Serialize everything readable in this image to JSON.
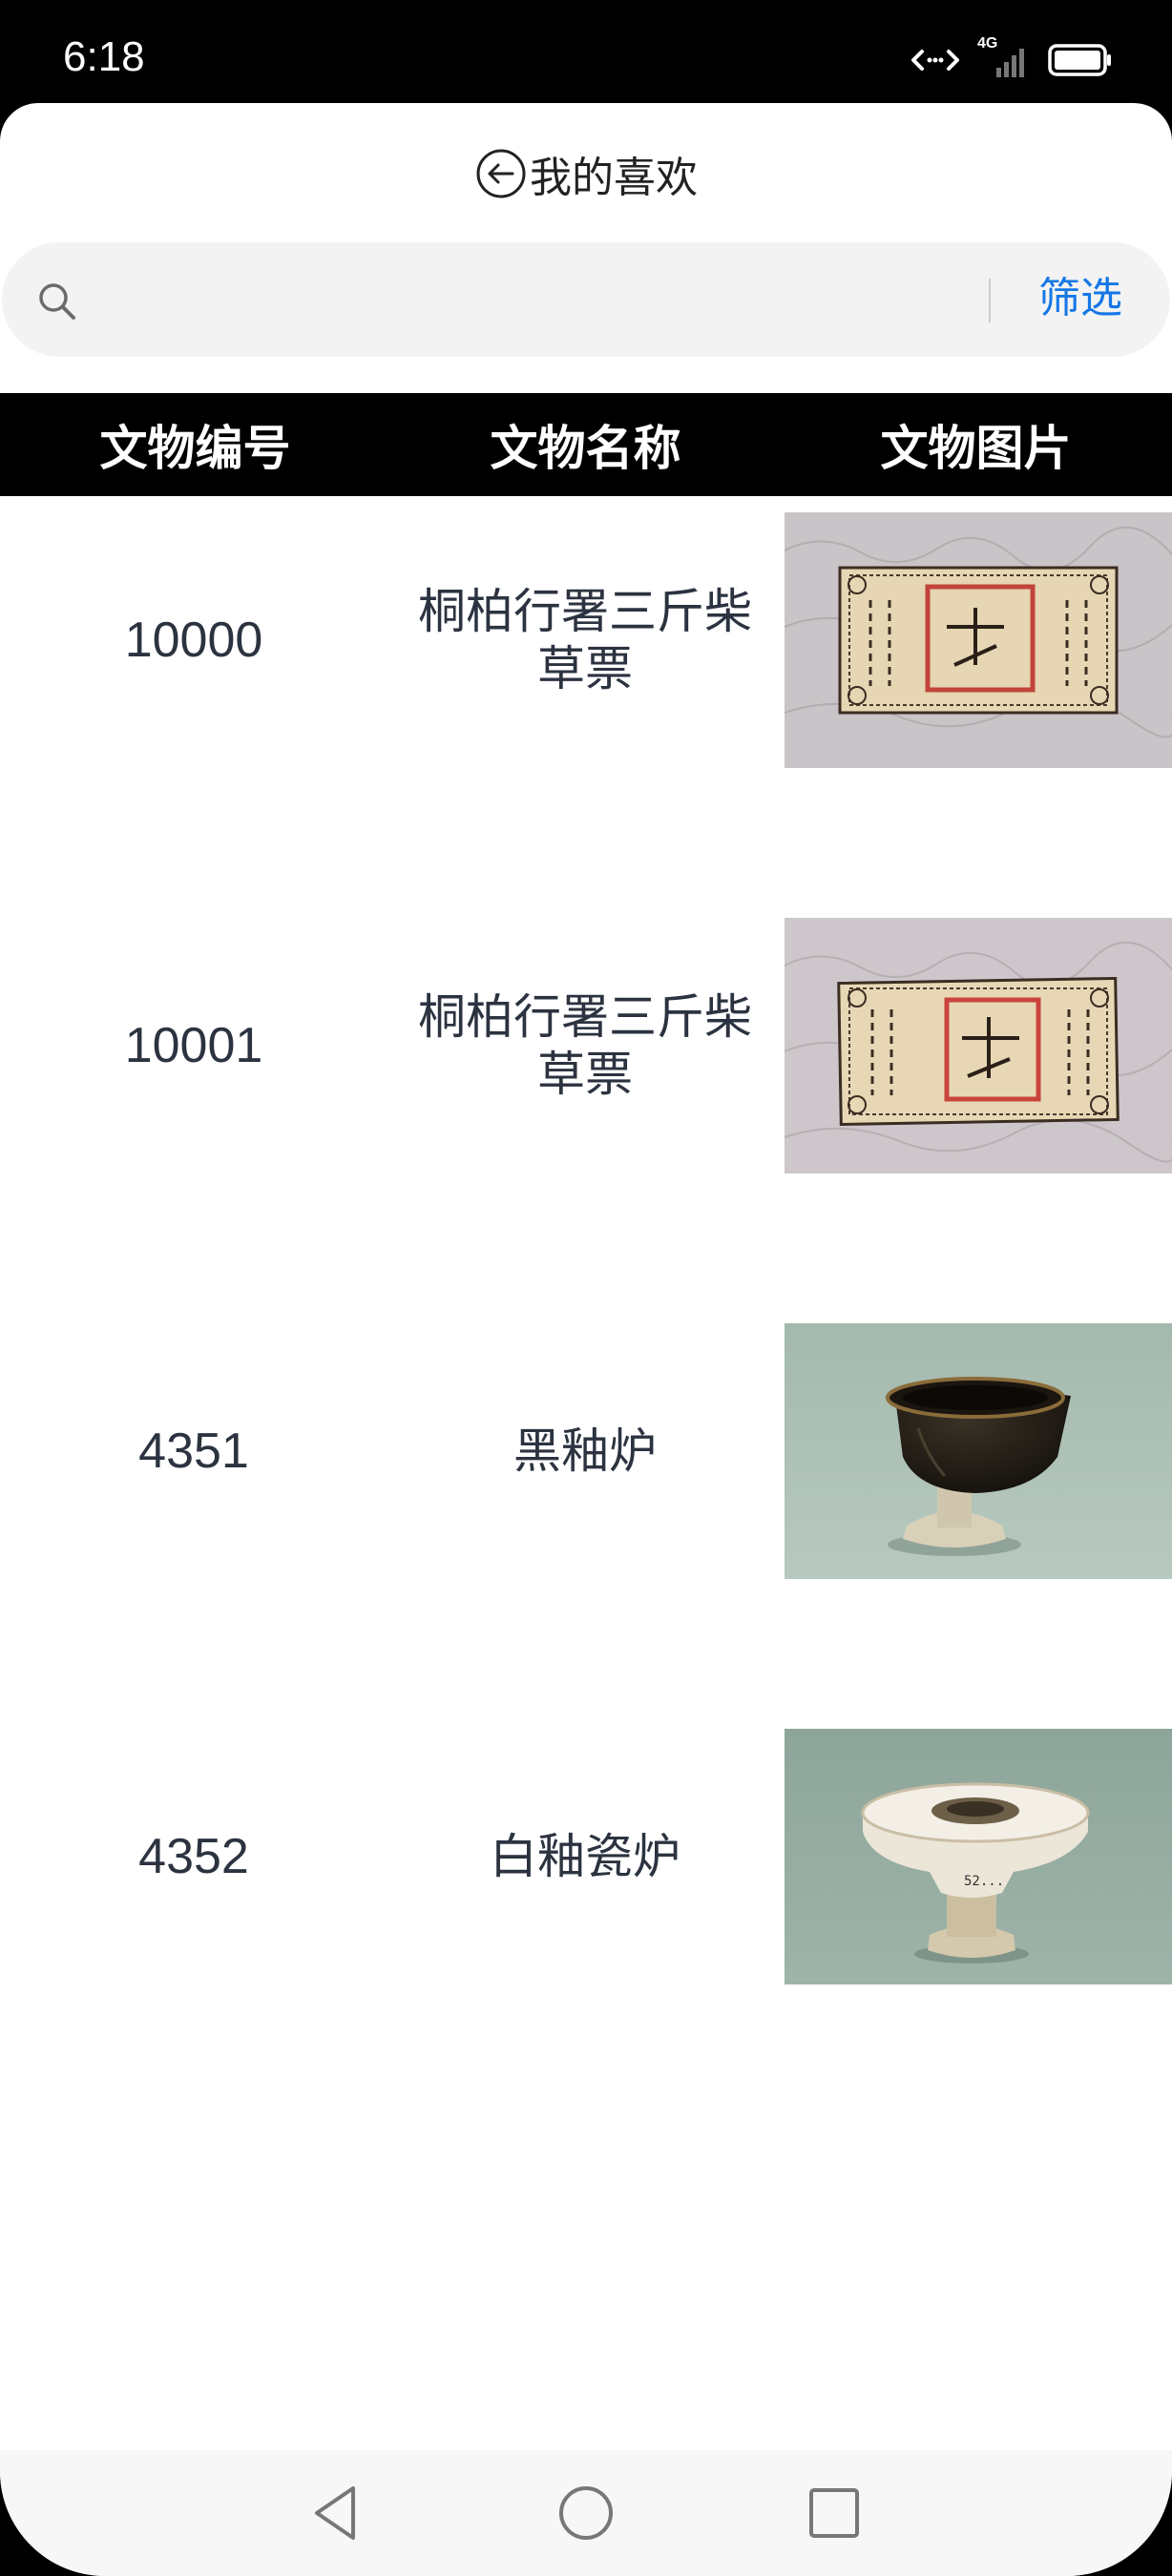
{
  "status_bar": {
    "time": "6:18",
    "network": "4G",
    "icons": [
      "data-transfer-icon",
      "signal-icon",
      "battery-icon"
    ]
  },
  "header": {
    "title": "我的喜欢",
    "back_icon": "back-arrow-circle-icon"
  },
  "search": {
    "placeholder": "",
    "value": "",
    "filter_label": "筛选"
  },
  "table": {
    "columns": [
      "文物编号",
      "文物名称",
      "文物图片"
    ],
    "rows": [
      {
        "id": "10000",
        "name": "桐柏行署三斤柴草票",
        "image": "paper-ticket-photo"
      },
      {
        "id": "10001",
        "name": "桐柏行署三斤柴草票",
        "image": "paper-ticket-photo"
      },
      {
        "id": "4351",
        "name": "黑釉炉",
        "image": "black-glaze-censer-photo"
      },
      {
        "id": "4352",
        "name": "白釉瓷炉",
        "image": "white-glaze-censer-photo"
      }
    ]
  },
  "nav_bar": {
    "buttons": [
      "back-triangle-icon",
      "home-circle-icon",
      "recents-square-icon"
    ]
  },
  "colors": {
    "accent": "#1677e5",
    "header_bg": "#000000",
    "search_bg": "#f2f3f2",
    "text": "#2c3340"
  }
}
